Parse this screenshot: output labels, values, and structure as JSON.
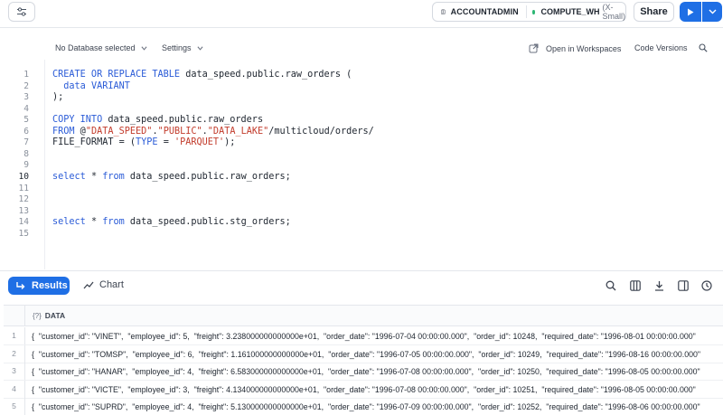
{
  "toolbar": {
    "role": "ACCOUNTADMIN",
    "warehouse": "COMPUTE_WH",
    "warehouse_size": "(X-Small)",
    "share_label": "Share"
  },
  "editor_bar": {
    "database": "No Database selected",
    "settings": "Settings",
    "open_workspaces": "Open in Workspaces",
    "code_versions": "Code Versions"
  },
  "code": {
    "active_line": 10,
    "lines": [
      {
        "n": "1",
        "tokens": [
          [
            "kw",
            "CREATE OR REPLACE TABLE"
          ],
          [
            "p",
            " data_speed.public.raw_orders ("
          ]
        ]
      },
      {
        "n": "2",
        "tokens": [
          [
            "p",
            "  "
          ],
          [
            "kw",
            "data VARIANT"
          ]
        ]
      },
      {
        "n": "3",
        "tokens": [
          [
            "p",
            ");"
          ]
        ]
      },
      {
        "n": "4",
        "tokens": []
      },
      {
        "n": "5",
        "tokens": [
          [
            "kw",
            "COPY INTO"
          ],
          [
            "p",
            " data_speed.public.raw_orders"
          ]
        ]
      },
      {
        "n": "6",
        "tokens": [
          [
            "kw",
            "FROM"
          ],
          [
            "p",
            " @"
          ],
          [
            "str",
            "\"DATA_SPEED\""
          ],
          [
            "p",
            "."
          ],
          [
            "str",
            "\"PUBLIC\""
          ],
          [
            "p",
            "."
          ],
          [
            "str",
            "\"DATA_LAKE\""
          ],
          [
            "p",
            "/multicloud/orders/"
          ]
        ]
      },
      {
        "n": "7",
        "tokens": [
          [
            "p",
            "FILE_FORMAT = ("
          ],
          [
            "kw",
            "TYPE"
          ],
          [
            "p",
            " = "
          ],
          [
            "str",
            "'PARQUET'"
          ],
          [
            "p",
            ");"
          ]
        ]
      },
      {
        "n": "8",
        "tokens": []
      },
      {
        "n": "9",
        "tokens": []
      },
      {
        "n": "10",
        "tokens": [
          [
            "kw",
            "select"
          ],
          [
            "p",
            " * "
          ],
          [
            "kw",
            "from"
          ],
          [
            "p",
            " data_speed.public.raw_orders;"
          ]
        ]
      },
      {
        "n": "11",
        "tokens": []
      },
      {
        "n": "12",
        "tokens": []
      },
      {
        "n": "13",
        "tokens": []
      },
      {
        "n": "14",
        "tokens": [
          [
            "kw",
            "select"
          ],
          [
            "p",
            " * "
          ],
          [
            "kw",
            "from"
          ],
          [
            "p",
            " data_speed.public.stg_orders;"
          ]
        ]
      },
      {
        "n": "15",
        "tokens": []
      }
    ]
  },
  "results": {
    "results_tab": "Results",
    "chart_tab": "Chart",
    "column_type": "{?}",
    "column_name": "DATA",
    "rows": [
      {
        "n": "1",
        "value": "{  \"customer_id\": \"VINET\",  \"employee_id\": 5,  \"freight\": 3.238000000000000e+01,  \"order_date\": \"1996-07-04 00:00:00.000\",  \"order_id\": 10248,  \"required_date\": \"1996-08-01 00:00:00.000\""
      },
      {
        "n": "2",
        "value": "{  \"customer_id\": \"TOMSP\",  \"employee_id\": 6,  \"freight\": 1.161000000000000e+01,  \"order_date\": \"1996-07-05 00:00:00.000\",  \"order_id\": 10249,  \"required_date\": \"1996-08-16 00:00:00.000\""
      },
      {
        "n": "3",
        "value": "{  \"customer_id\": \"HANAR\",  \"employee_id\": 4,  \"freight\": 6.583000000000000e+01,  \"order_date\": \"1996-07-08 00:00:00.000\",  \"order_id\": 10250,  \"required_date\": \"1996-08-05 00:00:00.000\""
      },
      {
        "n": "4",
        "value": "{  \"customer_id\": \"VICTE\",  \"employee_id\": 3,  \"freight\": 4.134000000000000e+01,  \"order_date\": \"1996-07-08 00:00:00.000\",  \"order_id\": 10251,  \"required_date\": \"1996-08-05 00:00:00.000\""
      },
      {
        "n": "5",
        "value": "{  \"customer_id\": \"SUPRD\",  \"employee_id\": 4,  \"freight\": 5.130000000000000e+01,  \"order_date\": \"1996-07-09 00:00:00.000\",  \"order_id\": 10252,  \"required_date\": \"1996-08-06 00:00:00.000\""
      }
    ]
  },
  "colors": {
    "accent": "#1f6fe5",
    "keyword": "#2a5bd7",
    "string": "#c23b2b",
    "status_dot": "#2bb673"
  },
  "icons": [
    "sliders-icon",
    "role-icon",
    "play-icon",
    "chevron-down-icon",
    "open-external-icon",
    "search-icon",
    "enter-arrow-icon",
    "chart-line-icon",
    "columns-icon",
    "download-icon",
    "split-pane-icon",
    "history-icon"
  ]
}
